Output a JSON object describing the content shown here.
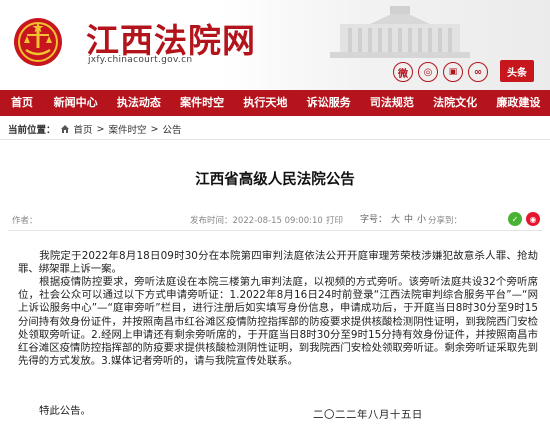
{
  "site": {
    "title": "江西法院网",
    "url": "jxfy.chinacourt.gov.cn",
    "toutiao_label": "头条",
    "social_icons": [
      "weibo-icon",
      "wechat-icon",
      "app-icon",
      "mini-program-icon"
    ]
  },
  "nav": {
    "items": [
      "首页",
      "新闻中心",
      "执法动态",
      "案件时空",
      "执行天地",
      "诉讼服务",
      "司法规范",
      "法院文化",
      "廉政建设"
    ]
  },
  "breadcrumb": {
    "current_label": "当前位置：",
    "home": "首页",
    "sep1": ">",
    "section": "案件时空",
    "sep2": ">",
    "leaf": "公告"
  },
  "article": {
    "title": "江西省高级人民法院公告",
    "source_label": "作者：",
    "publish_label": "发布时间：2022-08-15 09:00:10",
    "print_label": "打印",
    "font_label": "字号：",
    "font_sizes": [
      "大",
      "中",
      "小"
    ],
    "share_label": "分享到：",
    "p1": "我院定于2022年8月18日09时30分在本院第四审判法庭依法公开开庭审理芳荣枝涉嫌犯故意杀人罪、抢劫罪、绑架罪上诉一案。",
    "p2": "根据疫情防控要求，旁听法庭设在本院三楼第九审判法庭，以视频的方式旁听。该旁听法庭共设32个旁听席位，社会公众可以通过以下方式申请旁听证：1.2022年8月16日24时前登录“江西法院审判综合服务平台”—“网上诉讼服务中心”—“庭审旁听”栏目，进行注册后如实填写身份信息，申请成功后，于开庭当日8时30分至9时15分间持有效身份证件，并按照南昌市红谷滩区疫情防控指挥部的防疫要求提供核酸检测阴性证明，到我院西门安检处领取旁听证。2.经网上申请还有剩余旁听席的，于开庭当日8时30分至9时15分持有效身份证件，并按照南昌市红谷滩区疫情防控指挥部的防疫要求提供核酸检测阴性证明，到我院西门安检处领取旁听证。剩余旁听证采取先到先得的方式发放。3.媒体记者旁听的，请与我院宣传处联系。",
    "p3": "特此公告。",
    "signature_date": "二〇二二年八月十五日"
  },
  "colors": {
    "brand_red": "#b5141c",
    "title_red": "#b3141b",
    "wechat_green": "#49b233",
    "weibo_red": "#e6162d"
  }
}
